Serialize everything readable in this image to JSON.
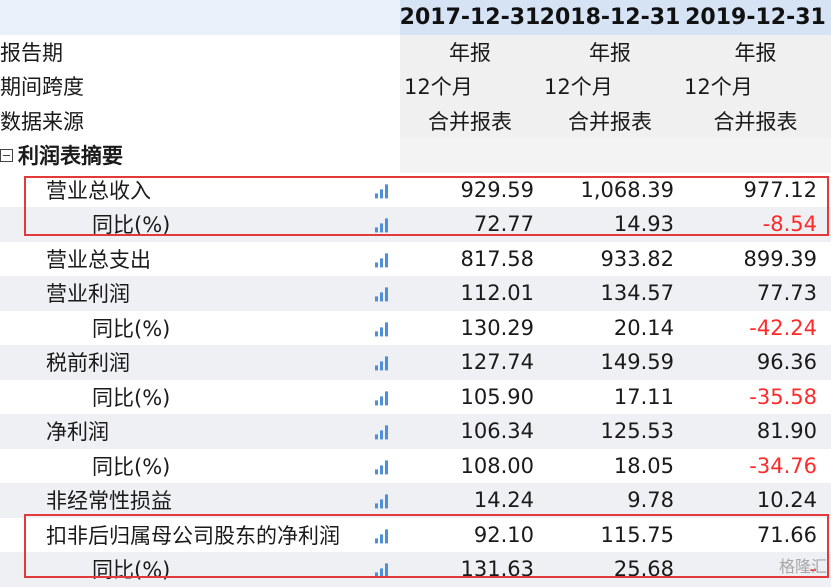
{
  "header": {
    "dates": [
      "2017-12-31",
      "2018-12-31",
      "2019-12-31"
    ]
  },
  "meta": [
    {
      "label": "报告期",
      "values": [
        "年报",
        "年报",
        "年报"
      ],
      "align": "center"
    },
    {
      "label": "期间跨度",
      "values": [
        "12个月",
        "12个月",
        "12个月"
      ],
      "align": "left"
    },
    {
      "label": "数据来源",
      "values": [
        "合并报表",
        "合并报表",
        "合并报表"
      ],
      "align": "center"
    }
  ],
  "section": {
    "label": "利润表摘要"
  },
  "rows": [
    {
      "label": "营业总收入",
      "level": 1,
      "values": [
        "929.59",
        "1,068.39",
        "977.12"
      ]
    },
    {
      "label": "同比(%)",
      "level": 2,
      "values": [
        "72.77",
        "14.93",
        "-8.54"
      ]
    },
    {
      "label": "营业总支出",
      "level": 1,
      "values": [
        "817.58",
        "933.82",
        "899.39"
      ]
    },
    {
      "label": "营业利润",
      "level": 1,
      "values": [
        "112.01",
        "134.57",
        "77.73"
      ]
    },
    {
      "label": "同比(%)",
      "level": 2,
      "values": [
        "130.29",
        "20.14",
        "-42.24"
      ]
    },
    {
      "label": "税前利润",
      "level": 1,
      "values": [
        "127.74",
        "149.59",
        "96.36"
      ]
    },
    {
      "label": "同比(%)",
      "level": 2,
      "values": [
        "105.90",
        "17.11",
        "-35.58"
      ]
    },
    {
      "label": "净利润",
      "level": 1,
      "values": [
        "106.34",
        "125.53",
        "81.90"
      ]
    },
    {
      "label": "同比(%)",
      "level": 2,
      "values": [
        "108.00",
        "18.05",
        "-34.76"
      ]
    },
    {
      "label": "非经常性损益",
      "level": 1,
      "values": [
        "14.24",
        "9.78",
        "10.24"
      ]
    },
    {
      "label": "扣非后归属母公司股东的净利润",
      "level": 1,
      "values": [
        "92.10",
        "115.75",
        "71.66"
      ]
    },
    {
      "label": "同比(%)",
      "level": 2,
      "values": [
        "131.63",
        "25.68",
        "-"
      ]
    }
  ],
  "colors": {
    "accent": "#4f8fd8",
    "negative": "#ff2a2a",
    "highlight": "#e23a3a",
    "header_bg": "#d5e3f5"
  },
  "watermark": "格隆汇"
}
